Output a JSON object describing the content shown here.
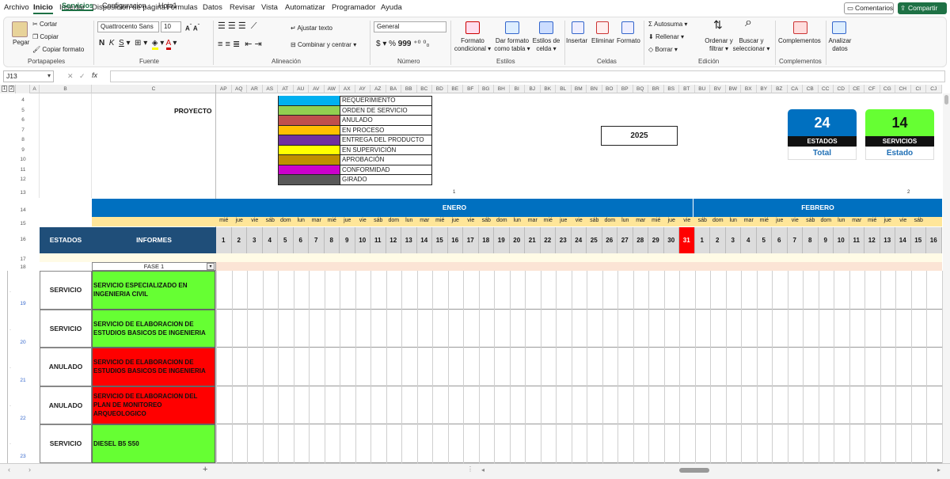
{
  "menu": {
    "items": [
      "Archivo",
      "Inicio",
      "Insertar",
      "Disposición de página",
      "Fórmulas",
      "Datos",
      "Revisar",
      "Vista",
      "Automatizar",
      "Programador",
      "Ayuda"
    ],
    "comments": "Comentarios",
    "share": "Compartir"
  },
  "ribbon": {
    "paste": "Pegar",
    "cut": "Cortar",
    "copy": "Copiar",
    "format_painter": "Copiar formato",
    "clipboard_label": "Portapapeles",
    "font_name": "Quattrocento Sans",
    "font_size": "10",
    "font_label": "Fuente",
    "wrap_text": "Ajustar texto",
    "merge_center": "Combinar y centrar",
    "alignment_label": "Alineación",
    "number_format": "General",
    "number_label": "Número",
    "cond_format": [
      "Formato",
      "condicional"
    ],
    "format_table": [
      "Dar formato",
      "como tabla"
    ],
    "cell_styles": [
      "Estilos de",
      "celda"
    ],
    "styles_label": "Estilos",
    "insert": "Insertar",
    "delete": "Eliminar",
    "format": "Formato",
    "cells_label": "Celdas",
    "autosum": "Autosuma",
    "fill": "Rellenar",
    "clear": "Borrar",
    "sort_filter": [
      "Ordenar y",
      "filtrar"
    ],
    "find_select": [
      "Buscar y",
      "seleccionar"
    ],
    "editing_label": "Edición",
    "addins": "Complementos",
    "addins_label": "Complementos",
    "analyze": [
      "Analizar",
      "datos"
    ]
  },
  "formula_bar": {
    "name_box": "J13",
    "fx": "fx",
    "value": ""
  },
  "colors": {
    "blue_header": "#0070c0",
    "dark_blue": "#1f4e79",
    "green": "#66ff33",
    "red": "#ff0000",
    "tile_blue": "#0070c0",
    "tile_green": "#66ff33",
    "holiday_red": "#ff0000",
    "day_names_bg": "#ffe699"
  },
  "columns_right": [
    "AP",
    "AQ",
    "AR",
    "AS",
    "AT",
    "AU",
    "AV",
    "AW",
    "AX",
    "AY",
    "AZ",
    "BA",
    "BB",
    "BC",
    "BD",
    "BE",
    "BF",
    "BG",
    "BH",
    "BI",
    "BJ",
    "BK",
    "BL",
    "BM",
    "BN",
    "BO",
    "BP",
    "BQ",
    "BR",
    "BS",
    "BT",
    "BU",
    "BV",
    "BW",
    "BX",
    "BY",
    "BZ",
    "CA",
    "CB",
    "CC",
    "CD",
    "CE",
    "CF",
    "CG",
    "CH",
    "CI",
    "CJ"
  ],
  "columns_left": [
    "A",
    "B",
    "C"
  ],
  "row_numbers": [
    "4",
    "5",
    "6",
    "7",
    "8",
    "9",
    "10",
    "11",
    "12",
    "13",
    "14",
    "15",
    "16",
    "17",
    "18",
    "19",
    "20",
    "21",
    "22",
    "23"
  ],
  "project_label": "PROYECTO",
  "year": "2025",
  "legend": [
    {
      "label": "REQUERIMIENTO",
      "color": "#00b0f0"
    },
    {
      "label": "ORDEN DE SERVICIO",
      "color": "#92d050"
    },
    {
      "label": "ANULADO",
      "color": "#c0504d"
    },
    {
      "label": "EN PROCESO",
      "color": "#ffc000"
    },
    {
      "label": "ENTREGA DEL PRODUCTO",
      "color": "#7030a0"
    },
    {
      "label": "EN SUPERVICIÓN",
      "color": "#ffff00"
    },
    {
      "label": "APROBACIÓN",
      "color": "#bf8f00"
    },
    {
      "label": "CONFORMIDAD",
      "color": "#cc00cc"
    },
    {
      "label": "GIRADO",
      "color": "#595959"
    }
  ],
  "tiles": [
    {
      "number": "24",
      "label": "ESTADOS",
      "caption": "Total"
    },
    {
      "number": "14",
      "label": "SERVICIOS",
      "caption": "Estado"
    }
  ],
  "month_markers": [
    "1",
    "2"
  ],
  "months": [
    "ENERO",
    "FEBRERO"
  ],
  "header": {
    "estados": "ESTADOS",
    "informes": "INFORMES",
    "phase": "FASE 1"
  },
  "day_names": [
    "mié",
    "jue",
    "vie",
    "sáb",
    "dom",
    "lun",
    "mar",
    "mié",
    "jue",
    "vie",
    "sáb",
    "dom",
    "lun",
    "mar",
    "mié",
    "jue",
    "vie",
    "sáb",
    "dom",
    "lun",
    "mar",
    "mié",
    "jue",
    "vie",
    "sáb",
    "dom",
    "lun",
    "mar",
    "mié",
    "jue",
    "vie",
    "sáb",
    "dom",
    "lun",
    "mar",
    "mié",
    "jue",
    "vie",
    "sáb",
    "dom",
    "lun",
    "mar",
    "mié",
    "jue",
    "vie",
    "sáb"
  ],
  "day_numbers": [
    "1",
    "2",
    "3",
    "4",
    "5",
    "6",
    "7",
    "8",
    "9",
    "10",
    "11",
    "12",
    "13",
    "14",
    "15",
    "16",
    "17",
    "18",
    "19",
    "20",
    "21",
    "22",
    "23",
    "24",
    "25",
    "26",
    "27",
    "28",
    "29",
    "30",
    "31",
    "1",
    "2",
    "3",
    "4",
    "5",
    "6",
    "7",
    "8",
    "9",
    "10",
    "11",
    "12",
    "13",
    "14",
    "15",
    "16"
  ],
  "rows": [
    {
      "estado": "SERVICIO",
      "informe": "SERVICIO ESPECIALIZADO EN INGENIERIA CIVIL",
      "color": "#66ff33",
      "row": "19"
    },
    {
      "estado": "SERVICIO",
      "informe": "SERVICIO DE ELABORACION DE ESTUDIOS BASICOS DE INGENIERIA",
      "color": "#66ff33",
      "row": "20"
    },
    {
      "estado": "ANULADO",
      "informe": "SERVICIO DE ELABORACION DE ESTUDIOS BASICOS DE INGENIERIA",
      "color": "#ff0000",
      "row": "21"
    },
    {
      "estado": "ANULADO",
      "informe": "SERVICIO DE ELABORACION DEL PLAN DE MONITOREO ARQUEOLOGICO",
      "color": "#ff0000",
      "row": "22"
    },
    {
      "estado": "SERVICIO",
      "informe": "DIESEL B5 S50",
      "color": "#66ff33",
      "row": "23"
    }
  ],
  "sheets": [
    "Servicios",
    "Configuracion",
    "Hoja1"
  ],
  "outline_levels": [
    "1",
    "2"
  ]
}
